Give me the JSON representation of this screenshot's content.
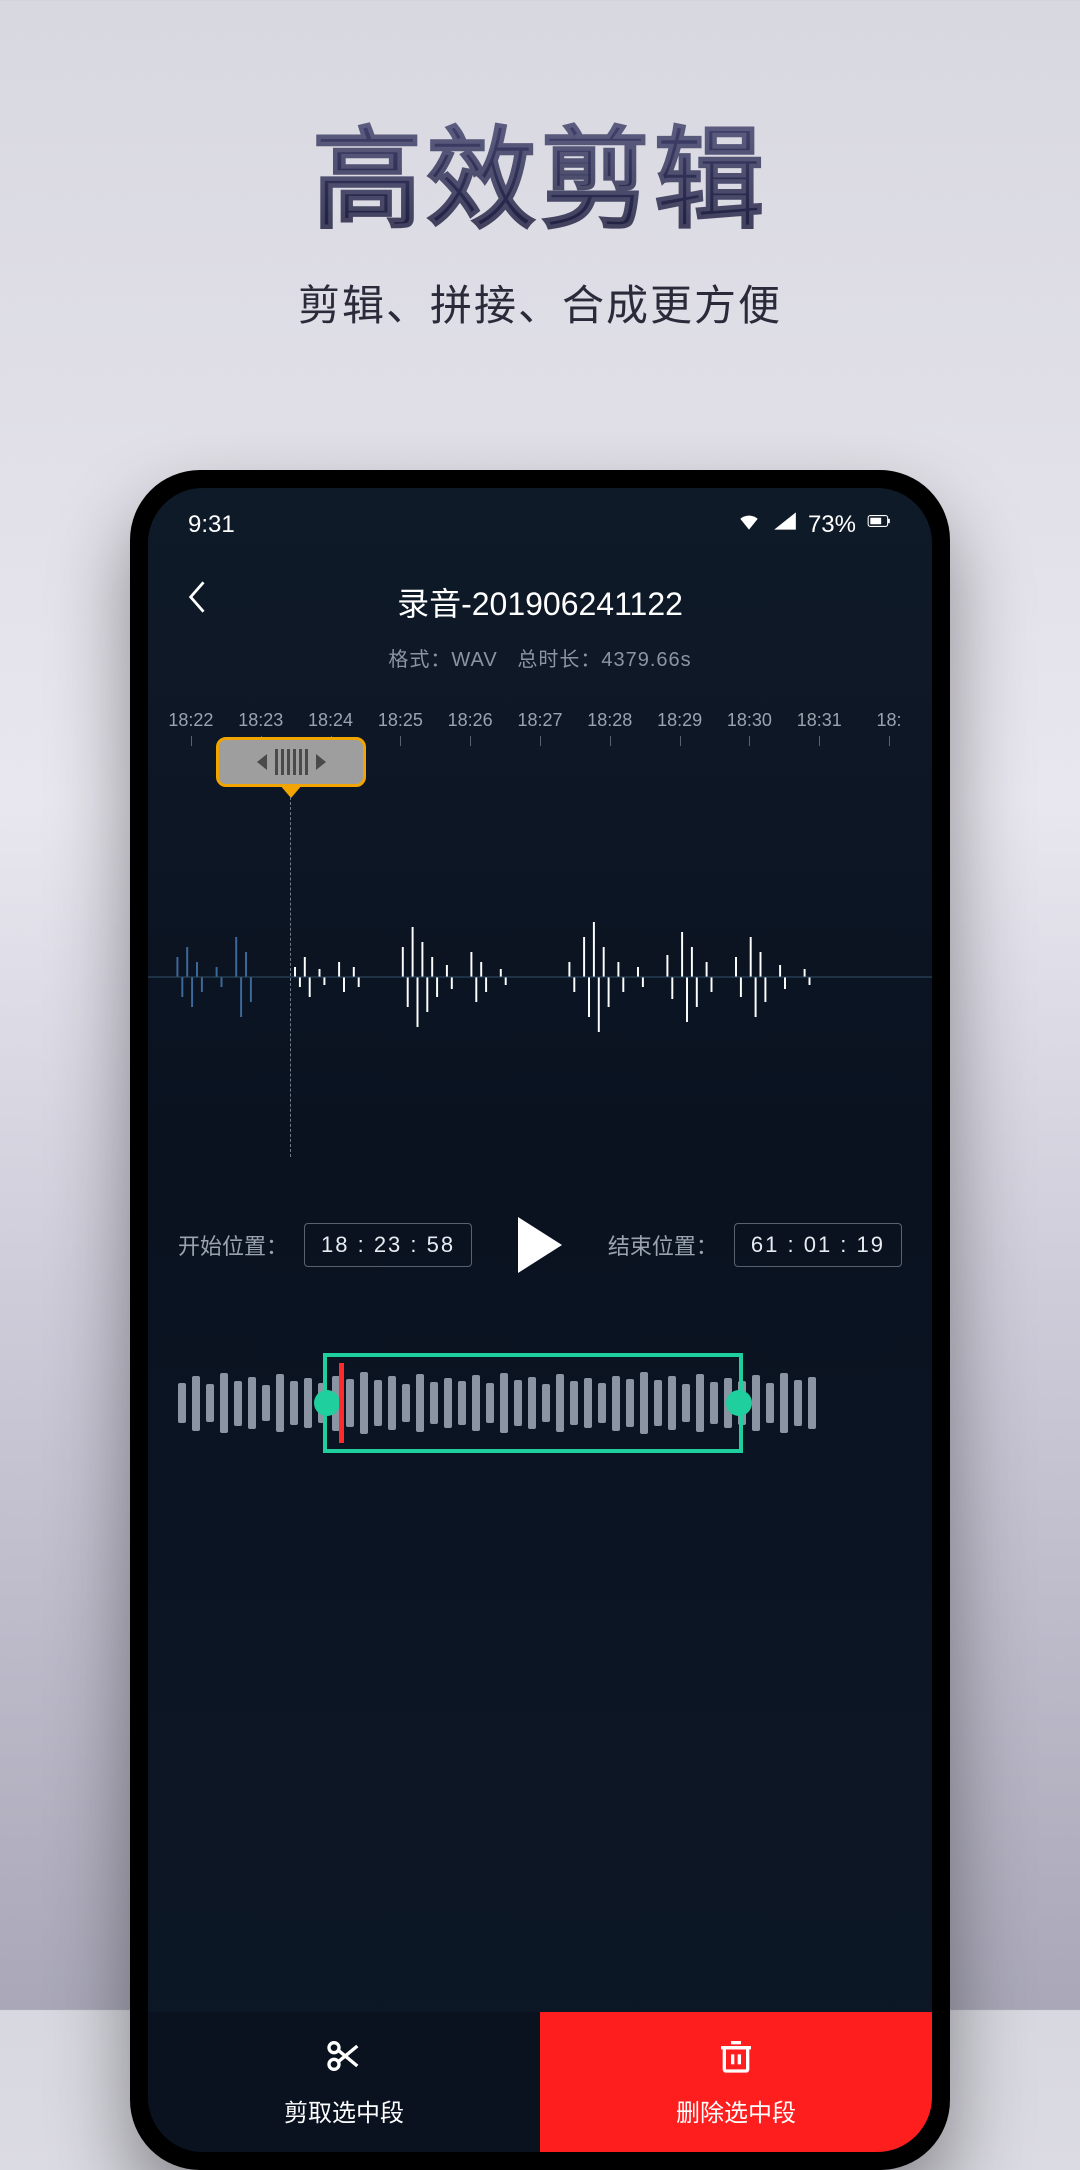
{
  "hero": {
    "title": "高效剪辑",
    "subtitle": "剪辑、拼接、合成更方便"
  },
  "status": {
    "time": "9:31",
    "battery": "73%"
  },
  "header": {
    "title": "录音-201906241122",
    "format_label": "格式：",
    "format_value": "WAV",
    "duration_label": "总时长：",
    "duration_value": "4379.66s"
  },
  "ruler": {
    "ticks": [
      "18:22",
      "18:23",
      "18:24",
      "18:25",
      "18:26",
      "18:27",
      "18:28",
      "18:29",
      "18:30",
      "18:31",
      "18:"
    ]
  },
  "controls": {
    "start_label": "开始位置：",
    "start_value": "18 : 23 : 58",
    "end_label": "结束位置：",
    "end_value": "61 : 01 : 19"
  },
  "actions": {
    "cut": "剪取选中段",
    "delete": "删除选中段"
  }
}
